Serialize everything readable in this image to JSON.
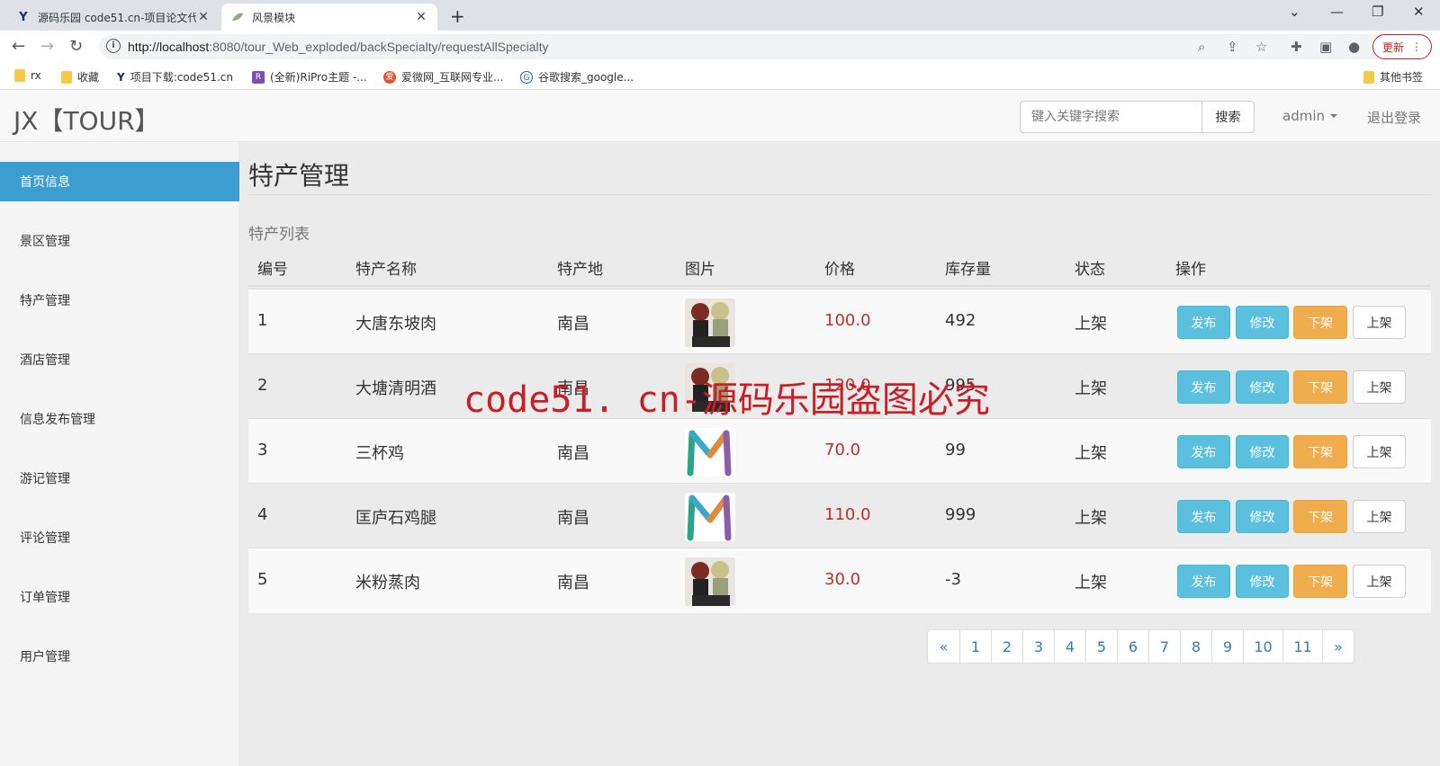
{
  "browser": {
    "tabs": [
      {
        "title": "源码乐园 code51.cn-项目论文代",
        "favicon": "Y"
      },
      {
        "title": "风景模块",
        "favicon": "leaf-icon"
      }
    ],
    "url_host": "http://localhost",
    "url_path": ":8080/tour_Web_exploded/backSpecialty/requestAllSpecialty",
    "update_label": "更新",
    "bookmarks": [
      "rx",
      "收藏",
      "项目下载:code51.cn",
      "(全新)RiPro主题 -...",
      "爱微网_互联网专业...",
      "谷歌搜索_google..."
    ],
    "other_bookmarks": "其他书签"
  },
  "header": {
    "brand": "JX【TOUR】",
    "search_placeholder": "键入关键字搜索",
    "search_button": "搜索",
    "user": "admin",
    "logout": "退出登录"
  },
  "sidebar": {
    "items": [
      "首页信息",
      "景区管理",
      "特产管理",
      "酒店管理",
      "信息发布管理",
      "游记管理",
      "评论管理",
      "订单管理",
      "用户管理"
    ]
  },
  "main": {
    "title": "特产管理",
    "subtitle": "特产列表",
    "columns": [
      "编号",
      "特产名称",
      "特产地",
      "图片",
      "价格",
      "库存量",
      "状态",
      "操作"
    ],
    "rows": [
      {
        "id": "1",
        "name": "大唐东坡肉",
        "origin": "南昌",
        "image": "anime",
        "price": "100.0",
        "stock": "492",
        "status": "上架"
      },
      {
        "id": "2",
        "name": "大塘清明酒",
        "origin": "南昌",
        "image": "anime",
        "price": "120.0",
        "stock": "995",
        "status": "上架"
      },
      {
        "id": "3",
        "name": "三杯鸡",
        "origin": "南昌",
        "image": "m-logo",
        "price": "70.0",
        "stock": "99",
        "status": "上架"
      },
      {
        "id": "4",
        "name": "匡庐石鸡腿",
        "origin": "南昌",
        "image": "m-logo",
        "price": "110.0",
        "stock": "999",
        "status": "上架"
      },
      {
        "id": "5",
        "name": "米粉蒸肉",
        "origin": "南昌",
        "image": "anime",
        "price": "30.0",
        "stock": "-3",
        "status": "上架"
      }
    ],
    "actions": {
      "publish": "发布",
      "edit": "修改",
      "off": "下架",
      "on": "上架"
    },
    "pagination": [
      "«",
      "1",
      "2",
      "3",
      "4",
      "5",
      "6",
      "7",
      "8",
      "9",
      "10",
      "11",
      "»"
    ]
  },
  "watermark": "code51. cn-源码乐园盗图必究",
  "colors": {
    "sidebar_active": "#3c9dd0",
    "info": "#5bc0de",
    "warning": "#f0ad4e",
    "price": "#c12e2a",
    "link": "#337ab7"
  }
}
